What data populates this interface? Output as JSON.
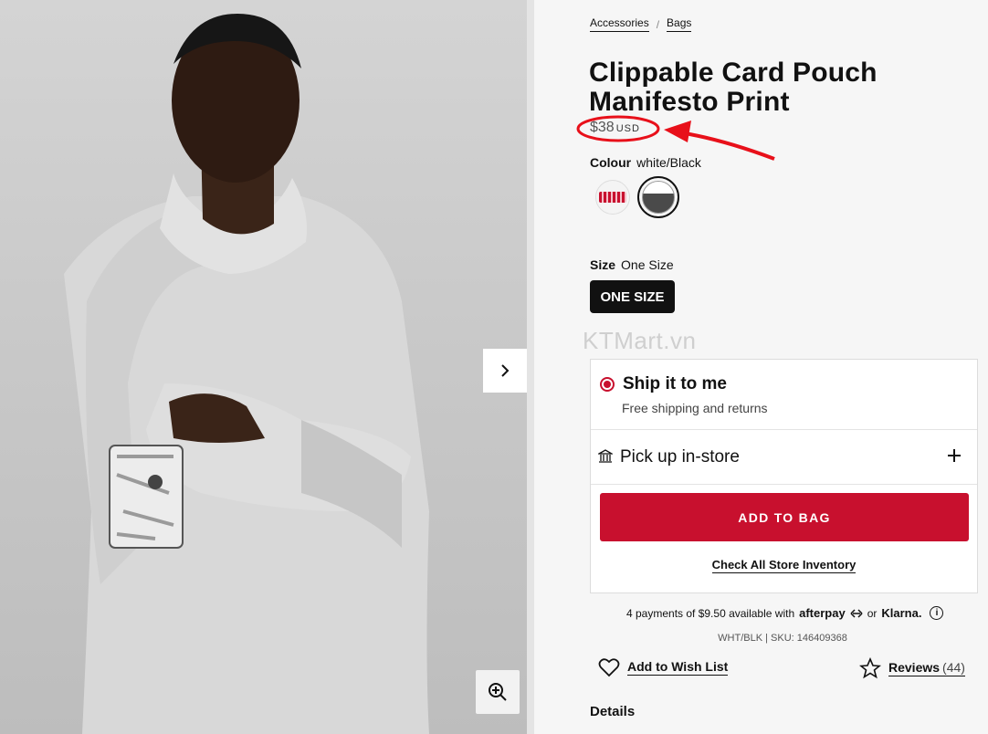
{
  "breadcrumb": {
    "items": [
      "Accessories",
      "Bags"
    ],
    "separator": "/"
  },
  "product": {
    "title": "Clippable Card Pouch Manifesto Print",
    "price": "$38",
    "currency": "USD"
  },
  "colour": {
    "label": "Colour",
    "selected": "white/Black"
  },
  "size": {
    "label": "Size",
    "selected": "One Size",
    "button": "ONE SIZE"
  },
  "watermark": "KTMart.vn",
  "shipping": {
    "ship_title": "Ship it to me",
    "ship_subtitle": "Free shipping and returns",
    "pickup_label": "Pick up in-store",
    "add_to_bag": "ADD TO BAG",
    "inventory_link": "Check All Store Inventory"
  },
  "payments": {
    "text": "4 payments of $9.50 available with",
    "brand_1": "afterpay",
    "or": "or",
    "brand_2": "Klarna."
  },
  "sku": "WHT/BLK | SKU: 146409368",
  "actions": {
    "wishlist": "Add to Wish List",
    "reviews": "Reviews",
    "reviews_count": "(44)"
  },
  "details_heading": "Details",
  "colors": {
    "accent": "#c8102e",
    "annotation": "#e8101a"
  }
}
